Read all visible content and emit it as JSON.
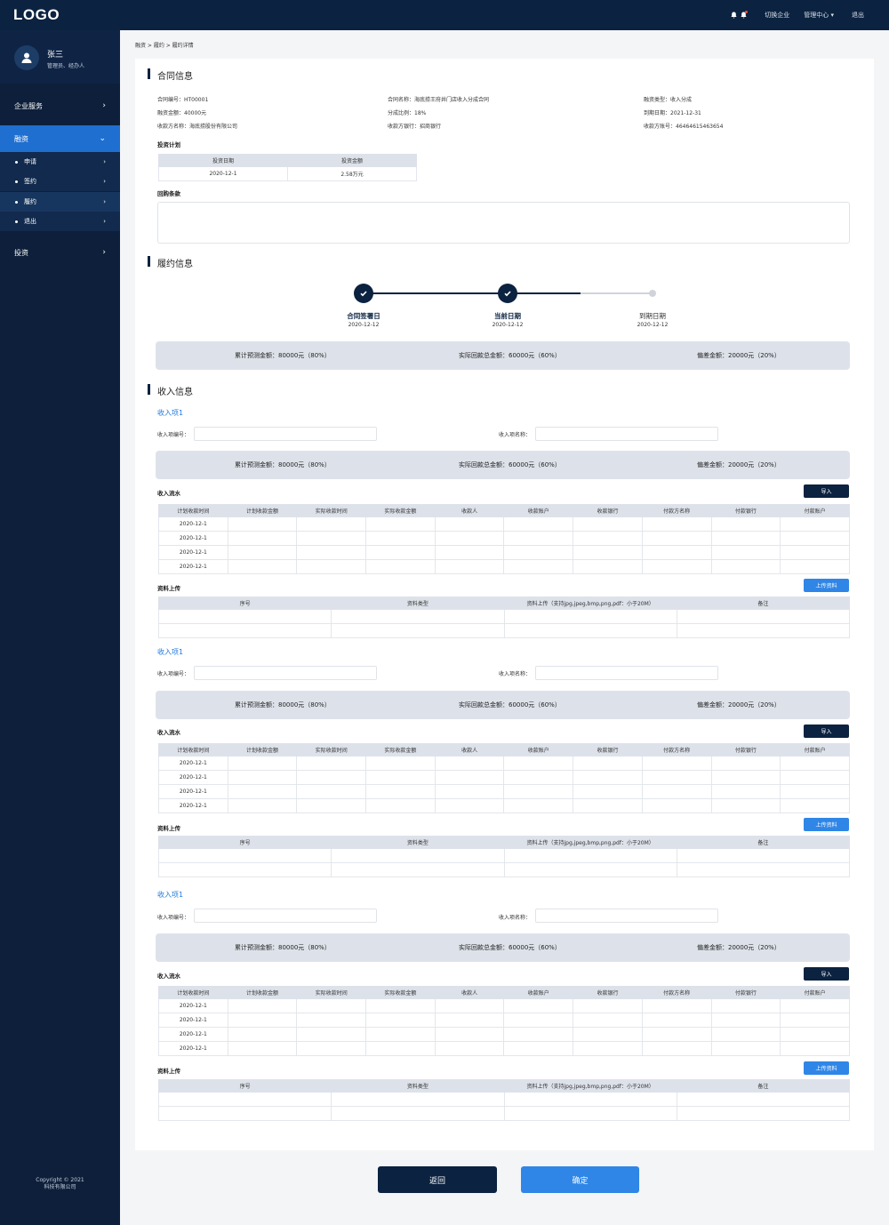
{
  "header": {
    "logo": "LOGO",
    "switch_company": "切换企业",
    "admin_center": "管理中心 ▾",
    "logout": "退出"
  },
  "user": {
    "name": "张三",
    "role": "管理员、经办人"
  },
  "sidebar": {
    "items": [
      {
        "label": "企业服务"
      },
      {
        "label": "融资"
      },
      {
        "label": "投资"
      }
    ],
    "subitems": [
      {
        "label": "申请"
      },
      {
        "label": "签约"
      },
      {
        "label": "履约"
      },
      {
        "label": "退出"
      }
    ],
    "copyright_line1": "Copyright © 2021",
    "copyright_line2": "科技有限公司"
  },
  "breadcrumb": "融资 > 履约 > 履约详情",
  "contract": {
    "title": "合同信息",
    "fields": [
      "合同编号：HT00001",
      "合同名称：海底捞王府井门店收入分成合同",
      "融资类型：收入分成",
      "融资金额：40000元",
      "分成比例：18%",
      "到期日期：2021-12-31",
      "收款方名称：海底捞股份有限公司",
      "收款方银行：招商银行",
      "收款方账号：46464615463654"
    ],
    "plan_label": "投资计划",
    "plan_headers": [
      "投资日期",
      "投资金额"
    ],
    "plan_rows": [
      [
        "2020-12-1",
        "2.58万元"
      ]
    ],
    "buyback_label": "回购条款"
  },
  "performance": {
    "title": "履约信息",
    "steps": [
      {
        "label": "合同签署日",
        "date": "2020-12-12"
      },
      {
        "label": "当前日期",
        "date": "2020-12-12"
      },
      {
        "label": "到期日期",
        "date": "2020-12-12"
      }
    ],
    "summary": {
      "forecast": "累计预测金额：80000元（80%）",
      "actual": "实际回款总金额：60000元（60%）",
      "deviation": "偏差金额：20000元（20%）"
    }
  },
  "income": {
    "title": "收入信息",
    "item_title": "收入项1",
    "code_label": "收入项编号：",
    "name_label": "收入项名称：",
    "summary": {
      "forecast": "累计预测金额：80000元（80%）",
      "actual": "实际回款总金额：60000元（60%）",
      "deviation": "偏差金额：20000元（20%）"
    },
    "flow_label": "收入流水",
    "import_button": "导入",
    "flow_headers": [
      "计划收款时间",
      "计划收款金额",
      "实际收款时间",
      "实际收款金额",
      "收款人",
      "收款账户",
      "收款银行",
      "付款方名称",
      "付款银行",
      "付款账户"
    ],
    "flow_dates": [
      "2020-12-1",
      "2020-12-1",
      "2020-12-1",
      "2020-12-1"
    ],
    "upload_label": "资料上传",
    "upload_button": "上传资料",
    "upload_headers": [
      "序号",
      "资料类型",
      "资料上传（支持jpg,jpeg,bmp,png,pdf：小于20M）",
      "备注"
    ]
  },
  "footer": {
    "back": "返回",
    "confirm": "确定"
  }
}
